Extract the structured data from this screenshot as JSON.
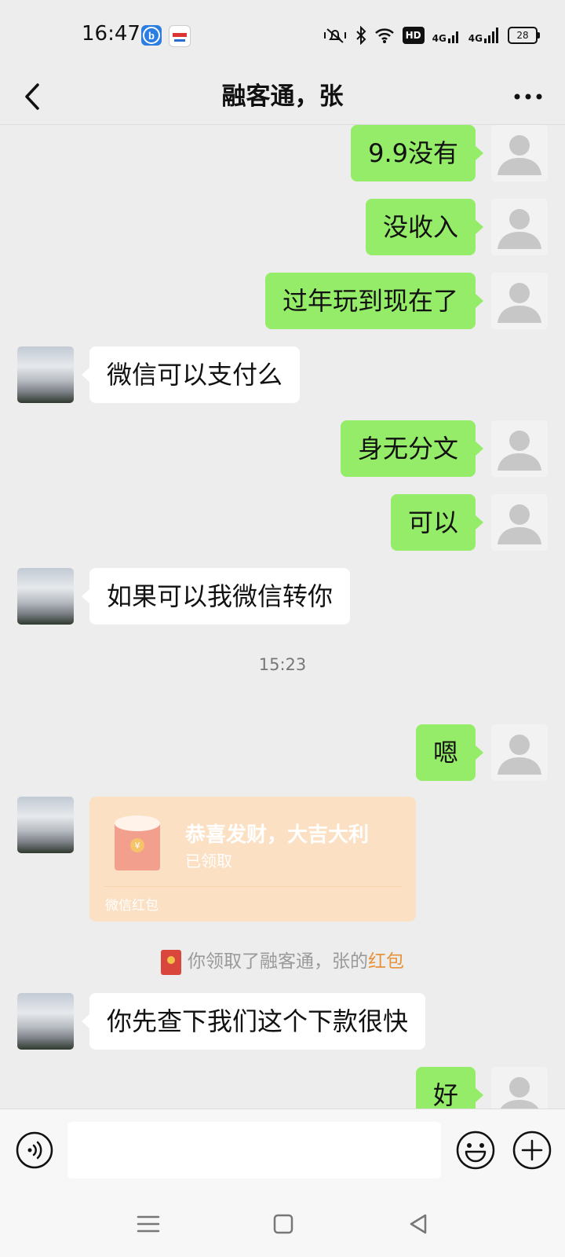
{
  "status_bar": {
    "time": "16:47",
    "network_1": "4G",
    "network_2": "4G",
    "hd_label": "HD",
    "battery": "28",
    "icons": [
      "mute-vibrate-icon",
      "bluetooth-icon",
      "wifi-icon",
      "hd-icon",
      "signal-4g-icon",
      "signal-4g-icon",
      "battery-icon"
    ]
  },
  "header": {
    "title": "融客通，张",
    "back_icon": "chevron-left-icon",
    "more_icon": "more-dots-icon"
  },
  "messages": [
    {
      "from": "me",
      "text": "9.9没有"
    },
    {
      "from": "me",
      "text": "没收入"
    },
    {
      "from": "me",
      "text": "过年玩到现在了"
    },
    {
      "from": "other",
      "text": "微信可以支付么"
    },
    {
      "from": "me",
      "text": "身无分文"
    },
    {
      "from": "me",
      "text": "可以"
    },
    {
      "from": "other",
      "text": "如果可以我微信转你"
    },
    {
      "from": "me",
      "text": "嗯"
    },
    {
      "from": "other",
      "text": "你先查下我们这个下款很快"
    },
    {
      "from": "me",
      "text": "好"
    }
  ],
  "timestamp": "15:23",
  "red_packet": {
    "title": "恭喜发财，大吉大利",
    "status": "已领取",
    "label": "微信红包",
    "symbol": "¥"
  },
  "notice": {
    "prefix": "你领取了融客通，张的",
    "link": "红包"
  },
  "input_bar": {
    "placeholder": "",
    "value": "",
    "voice_icon": "voice-icon",
    "emoji_icon": "emoji-icon",
    "plus_icon": "plus-circle-icon"
  },
  "nav_bar": {
    "icons": [
      "menu-icon",
      "home-icon",
      "back-triangle-icon"
    ]
  },
  "colors": {
    "my_bubble": "#95ec69",
    "other_bubble": "#ffffff",
    "background": "#ededed",
    "red_packet_bg": "#fbe0c3",
    "link_orange": "#e6923a"
  }
}
